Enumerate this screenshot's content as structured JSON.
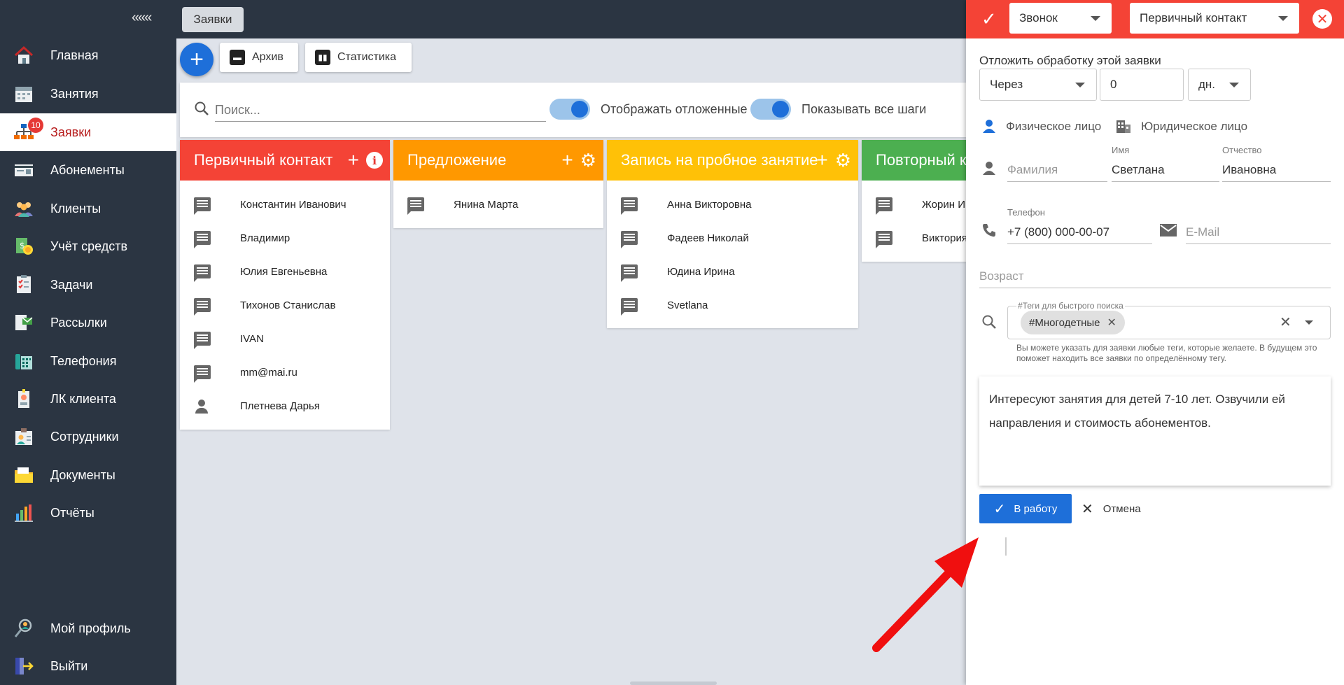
{
  "sidebar": {
    "collapse_label": "«««",
    "items": [
      {
        "label": "Главная",
        "icon": "home-icon"
      },
      {
        "label": "Занятия",
        "icon": "calendar-icon"
      },
      {
        "label": "Заявки",
        "icon": "network-icon",
        "badge": "10"
      },
      {
        "label": "Абонементы",
        "icon": "card-icon"
      },
      {
        "label": "Клиенты",
        "icon": "users-icon"
      },
      {
        "label": "Учёт средств",
        "icon": "money-icon"
      },
      {
        "label": "Задачи",
        "icon": "tasks-icon"
      },
      {
        "label": "Рассылки",
        "icon": "mail-icon"
      },
      {
        "label": "Телефония",
        "icon": "phone-icon"
      },
      {
        "label": "ЛК клиента",
        "icon": "id-badge-icon"
      },
      {
        "label": "Сотрудники",
        "icon": "staff-icon"
      },
      {
        "label": "Документы",
        "icon": "folder-icon"
      },
      {
        "label": "Отчёты",
        "icon": "chart-icon"
      }
    ],
    "profile_label": "Мой профиль",
    "logout_label": "Выйти"
  },
  "topbar": {
    "tab_label": "Заявки"
  },
  "toolbar": {
    "add_symbol": "+",
    "archive_label": "Архив",
    "stats_label": "Статистика"
  },
  "filters": {
    "search_placeholder": "Поиск...",
    "show_postponed_label": "Отображать отложенные",
    "show_postponed_on": true,
    "show_all_steps_label": "Показывать все шаги",
    "show_all_steps_on": true
  },
  "columns": [
    {
      "title": "Первичный контакт",
      "color": "#f44336",
      "cards": [
        "Константин Иванович",
        "Владимир",
        "Юлия Евгеньевна",
        "Тихонов Станислав",
        "IVAN",
        "mm@mai.ru",
        "Плетнева Дарья"
      ]
    },
    {
      "title": "Предложение",
      "color": "#ff9800",
      "cards": [
        "Янина Марта"
      ]
    },
    {
      "title": "Запись на пробное занятие",
      "color": "#ffc107",
      "cards": [
        "Анна Викторовна",
        "Фадеев Николай",
        "Юдина Ирина",
        "Svetlana"
      ]
    },
    {
      "title": "Повторный к",
      "color": "#4caf50",
      "cards": [
        "Жорин Иг",
        "Виктория"
      ]
    }
  ],
  "panel": {
    "header": {
      "type_value": "Звонок",
      "stage_value": "Первичный контакт",
      "accent": "#f44336"
    },
    "postpone_label": "Отложить обработку этой заявки",
    "postpone_mode": "Через",
    "postpone_amount": "0",
    "postpone_unit": "дн.",
    "person_type_individual": "Физическое лицо",
    "person_type_legal": "Юридическое лицо",
    "last_name_placeholder": "Фамилия",
    "first_name_label": "Имя",
    "first_name_value": "Светлана",
    "middle_name_label": "Отчество",
    "middle_name_value": "Ивановна",
    "phone_label": "Телефон",
    "phone_value": "+7 (800) 000-00-07",
    "email_placeholder": "E-Mail",
    "age_placeholder": "Возраст",
    "tags_label": "#Теги для быстрого поиска",
    "tag_chip": "#Многодетные",
    "tags_hint": "Вы можете указать для заявки любые теги, которые желаете. В будущем это поможет находить все заявки по определённому тегу.",
    "note_text": "Интересуют занятия для детей 7-10 лет. Озвучили ей направления и стоимость абонементов.",
    "submit_label": "В работу",
    "cancel_label": "Отмена"
  }
}
